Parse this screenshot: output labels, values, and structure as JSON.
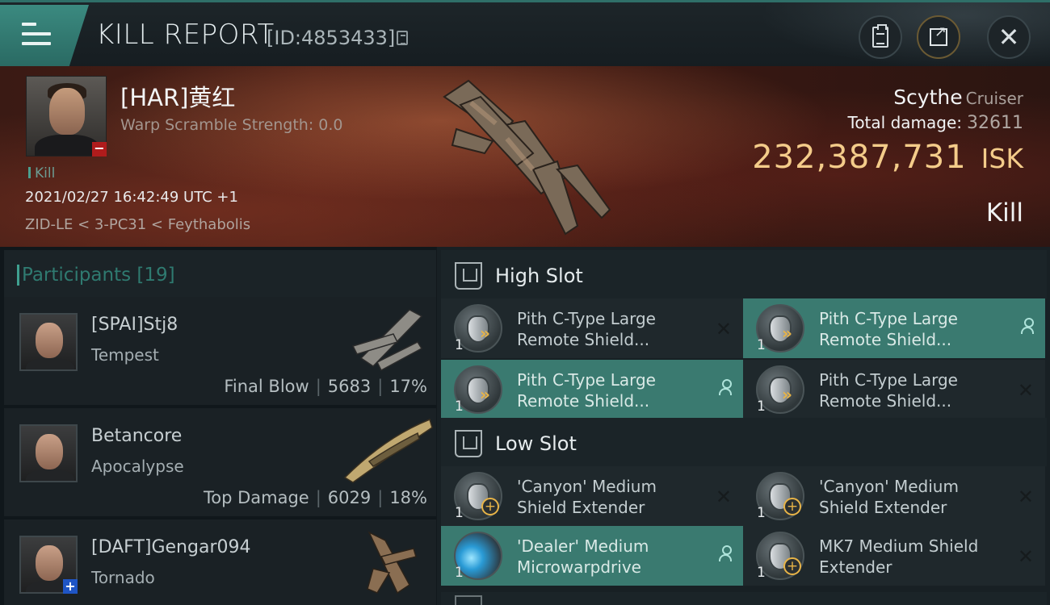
{
  "header": {
    "title": "KILL REPORT",
    "report_id": "[ID:4853433]"
  },
  "victim": {
    "name": "[HAR]黄红",
    "warp_scramble": "Warp Scramble Strength: 0.0",
    "kill_tag": "Kill",
    "datetime": "2021/02/27 16:42:49 UTC +1",
    "location": "ZID-LE < 3-PC31 < Feythabolis",
    "ship": "Scythe",
    "ship_class": "Cruiser",
    "total_damage_label": "Total damage:",
    "total_damage": "32611",
    "isk_value": "232,387,731",
    "isk_unit": "ISK",
    "result": "Kill"
  },
  "participants": {
    "label": "Participants",
    "count": "[19]",
    "rows": [
      {
        "name": "[SPAI]Stj8",
        "ship": "Tempest",
        "role": "Final Blow",
        "damage": "5683",
        "percent": "17%"
      },
      {
        "name": "Betancore",
        "ship": "Apocalypse",
        "role": "Top Damage",
        "damage": "6029",
        "percent": "18%"
      },
      {
        "name": "[DAFT]Gengar094",
        "ship": "Tornado",
        "role": "",
        "damage": "",
        "percent": ""
      }
    ]
  },
  "slots": {
    "high": {
      "label": "High Slot",
      "modules": [
        {
          "line1": "Pith C-Type Large",
          "line2": "Remote Shield...",
          "qty": "1",
          "action": "close-icon",
          "active": false
        },
        {
          "line1": "Pith C-Type Large",
          "line2": "Remote Shield...",
          "qty": "1",
          "action": "person-icon",
          "active": true
        },
        {
          "line1": "Pith C-Type Large",
          "line2": "Remote Shield...",
          "qty": "1",
          "action": "person-icon",
          "active": true
        },
        {
          "line1": "Pith C-Type Large",
          "line2": "Remote Shield...",
          "qty": "1",
          "action": "close-icon",
          "active": false
        }
      ]
    },
    "low": {
      "label": "Low Slot",
      "modules": [
        {
          "line1": "'Canyon' Medium",
          "line2": "Shield Extender",
          "qty": "1",
          "action": "close-icon",
          "active": false
        },
        {
          "line1": "'Canyon' Medium",
          "line2": "Shield Extender",
          "qty": "1",
          "action": "close-icon",
          "active": false
        },
        {
          "line1": "'Dealer' Medium",
          "line2": "Microwarpdrive",
          "qty": "1",
          "action": "person-icon",
          "active": true
        },
        {
          "line1": "MK7 Medium Shield",
          "line2": "Extender",
          "qty": "1",
          "action": "close-icon",
          "active": false
        }
      ]
    }
  },
  "colors": {
    "accent_teal": "#3a7a70",
    "isk_gold": "#f4cc8a",
    "badge_red": "#b01c1c",
    "badge_blue": "#1f55c5"
  }
}
